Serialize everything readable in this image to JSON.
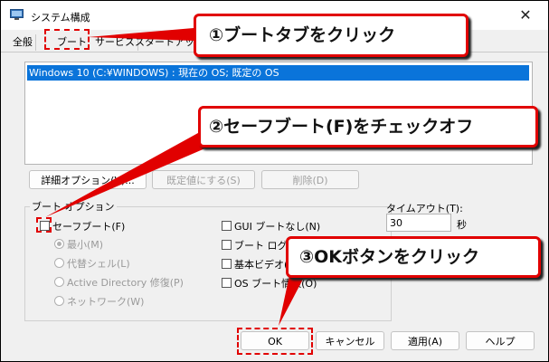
{
  "window": {
    "title": "システム構成",
    "close_glyph": "✕"
  },
  "tabs": [
    "全般",
    "ブート",
    "サービス",
    "スタートアップ",
    "ツ"
  ],
  "boot_list": {
    "entries": [
      "Windows 10 (C:¥WINDOWS) : 現在の OS; 既定の OS"
    ]
  },
  "buttons": {
    "advanced": "詳細オプション(V)...",
    "set_default": "既定値にする(S)",
    "delete": "削除(D)",
    "ok": "OK",
    "cancel": "キャンセル",
    "apply": "適用(A)",
    "help": "ヘルプ"
  },
  "boot_options": {
    "group_label": "ブート オプション",
    "safe_boot": "セーフブート(F)",
    "minimal": "最小(M)",
    "alternate_shell": "代替シェル(L)",
    "active_directory": "Active Directory 修復(P)",
    "network": "ネットワーク(W)",
    "no_gui": "GUI ブートなし(N)",
    "boot_log": "ブート ログ(B)",
    "base_video": "基本ビデオ(E)",
    "os_boot_info": "OS ブート情報(O)"
  },
  "timeout": {
    "label": "タイムアウト(T):",
    "value": "30",
    "unit": "秒"
  },
  "callouts": {
    "step1": "①ブートタブをクリック",
    "step2": "②セーフブート(F)をチェックオフ",
    "step3": "③OKボタンをクリック"
  },
  "colors": {
    "accent_red": "#e10000",
    "selection_blue": "#0a74da"
  }
}
